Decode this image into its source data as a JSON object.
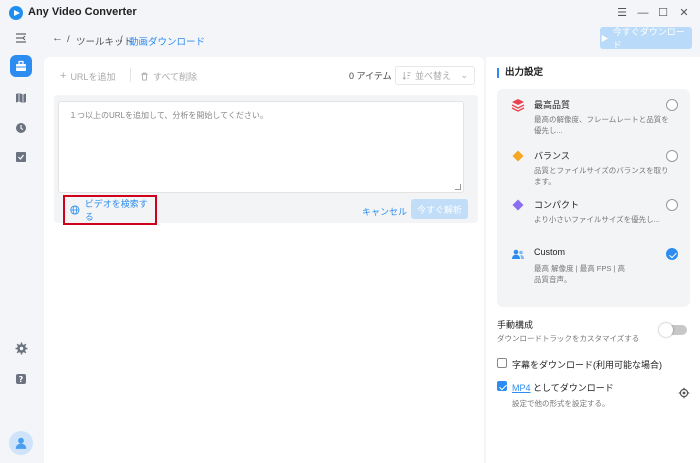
{
  "app": {
    "title": "Any Video Converter"
  },
  "window_controls": {
    "menu": "☰",
    "minimize": "—",
    "maximize": "☐",
    "close": "✕"
  },
  "breadcrumb": {
    "back": "←",
    "sep": "/",
    "toolkit": "ツールキット",
    "current": "動画ダウンロード"
  },
  "header": {
    "download_now": "今すぐダウンロード"
  },
  "toolbar": {
    "add_url": "URLを追加",
    "delete_all": "すべて削除",
    "item_count": "0 アイテム",
    "sort": "並べ替え"
  },
  "url_panel": {
    "placeholder": "１つ以上のURLを追加して、分析を開始してください。",
    "search_video": "ビデオを検索する",
    "cancel": "キャンセル",
    "analyze_now": "今すぐ解析"
  },
  "output_settings": {
    "title": "出力設定",
    "qualities": [
      {
        "name": "最高品質",
        "desc": "最高の解像度、フレームレートと品質を優先し...",
        "icon": "layers-icon",
        "color": "#e8424f",
        "selected": false
      },
      {
        "name": "バランス",
        "desc": "品質とファイルサイズのバランスを取ります。",
        "icon": "diamond-icon",
        "color": "#f5a623",
        "selected": false
      },
      {
        "name": "コンパクト",
        "desc": "より小さいファイルサイズを優先し...",
        "icon": "diamond-icon",
        "color": "#8b6df0",
        "selected": false
      },
      {
        "name": "Custom",
        "desc": "最高 解像度 | 最高 FPS | 高品質音声。",
        "icon": "users-icon",
        "color": "#2d8cf0",
        "selected": true
      }
    ],
    "manual_config": {
      "title": "手動構成",
      "subtitle": "ダウンロードトラックをカスタマイズする",
      "enabled": false
    },
    "subtitles": {
      "label": "字幕をダウンロード(利用可能な場合)",
      "checked": false
    },
    "mp4": {
      "link": "MP4",
      "label_rest": " としてダウンロード",
      "subtitle": "設定で他の形式を設定する。",
      "checked": true
    }
  }
}
